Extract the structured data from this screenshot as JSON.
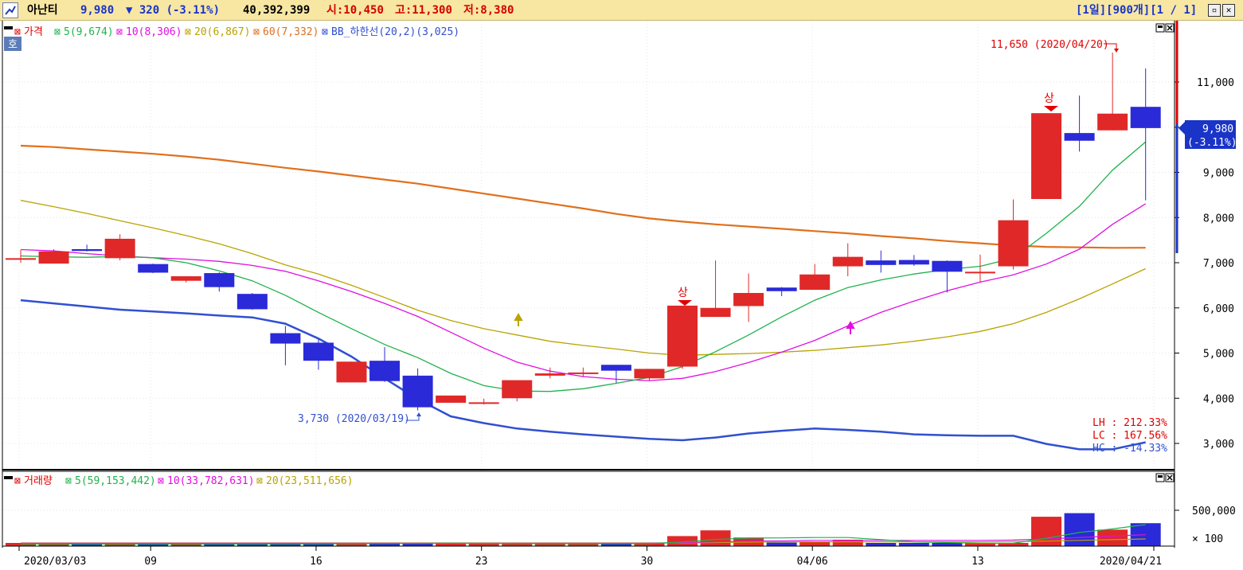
{
  "titlebar": {
    "stock_name": "아난티",
    "price": "9,980",
    "change": "▼ 320 (-3.11%)",
    "volume": "40,392,399",
    "open": "시:10,450",
    "high": "고:11,300",
    "low": "저:8,380",
    "period_controls": "[1일][900개][1 / 1]"
  },
  "price_panel": {
    "legend": [
      {
        "label": "가격",
        "color": "#e00000"
      },
      {
        "label": "5(9,674)",
        "color": "#1fb34a"
      },
      {
        "label": "10(8,306)",
        "color": "#e010e0"
      },
      {
        "label": "20(6,867)",
        "color": "#b8a400"
      },
      {
        "label": "60(7,332)",
        "color": "#e0701c"
      },
      {
        "label": "BB_하한선(20,2)(3,025)",
        "color": "#3050d0"
      }
    ],
    "ho_label": "호",
    "annotation_high": "11,650 (2020/04/20)",
    "annotation_low": "3,730 (2020/03/19)",
    "upper_limit_marks": [
      "상",
      "상"
    ],
    "current_price_badge": "9,980",
    "current_change_badge": "(-3.11%)",
    "lh": "LH : 212.33%",
    "lc": "LC : 167.56%",
    "hc": "HC : -14.33%"
  },
  "volume_panel": {
    "legend": [
      {
        "label": "거래량",
        "color": "#e00000"
      },
      {
        "label": "5(59,153,442)",
        "color": "#1fb34a"
      },
      {
        "label": "10(33,782,631)",
        "color": "#e010e0"
      },
      {
        "label": "20(23,511,656)",
        "color": "#b8a400"
      }
    ],
    "y_ticks": [
      "500,000",
      "× 100"
    ]
  },
  "x_axis": [
    "2020/03/03",
    "09",
    "16",
    "23",
    "30",
    "04/06",
    "13",
    "2020/04/21"
  ],
  "chart_data": {
    "type": "candlestick",
    "y_ticks": [
      3000,
      4000,
      5000,
      6000,
      7000,
      8000,
      9000,
      10000,
      11000
    ],
    "y_tick_labels": [
      "3,000",
      "4,000",
      "5,000",
      "6,000",
      "7,000",
      "8,000",
      "9,000",
      "10,000",
      "11,000"
    ],
    "ylim": [
      2500,
      12700
    ],
    "candles": [
      {
        "o": 7100,
        "h": 7280,
        "l": 7000,
        "c": 7100
      },
      {
        "o": 6980,
        "h": 7300,
        "l": 6980,
        "c": 7250
      },
      {
        "o": 7300,
        "h": 7400,
        "l": 7250,
        "c": 7260
      },
      {
        "o": 7100,
        "h": 7630,
        "l": 7050,
        "c": 7530
      },
      {
        "o": 6970,
        "h": 6980,
        "l": 6770,
        "c": 6780
      },
      {
        "o": 6600,
        "h": 6700,
        "l": 6560,
        "c": 6700
      },
      {
        "o": 6770,
        "h": 6790,
        "l": 6360,
        "c": 6460
      },
      {
        "o": 6310,
        "h": 6330,
        "l": 5960,
        "c": 5970
      },
      {
        "o": 5440,
        "h": 5600,
        "l": 4730,
        "c": 5210
      },
      {
        "o": 5230,
        "h": 5310,
        "l": 4630,
        "c": 4830
      },
      {
        "o": 4350,
        "h": 4810,
        "l": 4350,
        "c": 4810
      },
      {
        "o": 4830,
        "h": 5130,
        "l": 4360,
        "c": 4380
      },
      {
        "o": 4500,
        "h": 4660,
        "l": 3730,
        "c": 3800
      },
      {
        "o": 3900,
        "h": 4060,
        "l": 3900,
        "c": 4060
      },
      {
        "o": 3910,
        "h": 3990,
        "l": 3860,
        "c": 3910
      },
      {
        "o": 4000,
        "h": 4400,
        "l": 3930,
        "c": 4400
      },
      {
        "o": 4500,
        "h": 4680,
        "l": 4440,
        "c": 4550
      },
      {
        "o": 4560,
        "h": 4680,
        "l": 4470,
        "c": 4570
      },
      {
        "o": 4740,
        "h": 4740,
        "l": 4340,
        "c": 4610
      },
      {
        "o": 4440,
        "h": 4650,
        "l": 4380,
        "c": 4650
      },
      {
        "o": 4700,
        "h": 6050,
        "l": 4650,
        "c": 6050
      },
      {
        "o": 5800,
        "h": 7050,
        "l": 5800,
        "c": 6000
      },
      {
        "o": 6040,
        "h": 6760,
        "l": 5690,
        "c": 6330
      },
      {
        "o": 6450,
        "h": 6460,
        "l": 6260,
        "c": 6370
      },
      {
        "o": 6400,
        "h": 6970,
        "l": 6400,
        "c": 6740
      },
      {
        "o": 6920,
        "h": 7430,
        "l": 6700,
        "c": 7130
      },
      {
        "o": 7050,
        "h": 7270,
        "l": 6780,
        "c": 6950
      },
      {
        "o": 7060,
        "h": 7170,
        "l": 6930,
        "c": 6960
      },
      {
        "o": 7040,
        "h": 7050,
        "l": 6340,
        "c": 6800
      },
      {
        "o": 6800,
        "h": 7180,
        "l": 6570,
        "c": 6800
      },
      {
        "o": 6920,
        "h": 8400,
        "l": 6850,
        "c": 7940
      },
      {
        "o": 8410,
        "h": 10310,
        "l": 8410,
        "c": 10310
      },
      {
        "o": 9870,
        "h": 10700,
        "l": 9460,
        "c": 9700
      },
      {
        "o": 9930,
        "h": 11650,
        "l": 9930,
        "c": 10300
      },
      {
        "o": 10450,
        "h": 11300,
        "l": 8380,
        "c": 9980
      }
    ],
    "ma5": [
      7150,
      7130,
      7120,
      7140,
      7110,
      7000,
      6820,
      6600,
      6280,
      5900,
      5540,
      5190,
      4900,
      4550,
      4280,
      4160,
      4150,
      4210,
      4330,
      4460,
      4700,
      5030,
      5400,
      5800,
      6170,
      6450,
      6620,
      6750,
      6850,
      6920,
      7100,
      7650,
      8250,
      9050,
      9674
    ],
    "ma10": [
      7290,
      7260,
      7200,
      7150,
      7110,
      7080,
      7030,
      6940,
      6810,
      6600,
      6360,
      6100,
      5810,
      5460,
      5110,
      4800,
      4600,
      4480,
      4420,
      4390,
      4440,
      4590,
      4790,
      5020,
      5280,
      5600,
      5900,
      6150,
      6380,
      6570,
      6730,
      6970,
      7300,
      7850,
      8306
    ],
    "ma20": [
      8380,
      8240,
      8090,
      7930,
      7770,
      7600,
      7420,
      7200,
      6950,
      6750,
      6500,
      6230,
      5950,
      5720,
      5540,
      5400,
      5260,
      5170,
      5090,
      5000,
      4950,
      4970,
      4990,
      5020,
      5060,
      5120,
      5180,
      5260,
      5360,
      5480,
      5650,
      5900,
      6200,
      6530,
      6867
    ],
    "ma60": [
      9590,
      9560,
      9510,
      9460,
      9410,
      9350,
      9280,
      9190,
      9100,
      9020,
      8930,
      8840,
      8750,
      8640,
      8530,
      8420,
      8310,
      8200,
      8080,
      7980,
      7910,
      7850,
      7800,
      7750,
      7700,
      7650,
      7590,
      7540,
      7480,
      7430,
      7380,
      7350,
      7340,
      7330,
      7332
    ],
    "bb_lower": [
      6170,
      6100,
      6030,
      5960,
      5920,
      5880,
      5830,
      5790,
      5650,
      5320,
      4920,
      4440,
      3980,
      3600,
      3450,
      3330,
      3260,
      3200,
      3150,
      3100,
      3070,
      3130,
      3220,
      3280,
      3330,
      3300,
      3260,
      3200,
      3180,
      3170,
      3170,
      2990,
      2870,
      2870,
      3025
    ],
    "volume": [
      30000,
      30000,
      30000,
      30000,
      30000,
      30000,
      30000,
      30000,
      40000,
      40000,
      40000,
      40000,
      40000,
      30000,
      30000,
      30000,
      30000,
      40000,
      40000,
      40000,
      140000,
      220000,
      120000,
      50000,
      60000,
      90000,
      30000,
      30000,
      30000,
      30000,
      40000,
      410000,
      460000,
      230000,
      320000,
      230000
    ],
    "vol_ma5": [
      30000,
      30000,
      30000,
      30000,
      30000,
      30000,
      30000,
      30000,
      30000,
      32000,
      34000,
      36000,
      38000,
      40000,
      38000,
      36000,
      34000,
      34000,
      34000,
      36000,
      58000,
      92000,
      112000,
      114000,
      120000,
      120000,
      90000,
      60000,
      50000,
      40000,
      40000,
      110000,
      190000,
      240000,
      300000,
      330000
    ],
    "vol_ma10": [
      40000,
      40000,
      40000,
      40000,
      40000,
      40000,
      40000,
      40000,
      40000,
      40000,
      40000,
      40000,
      40000,
      40000,
      40000,
      40000,
      40000,
      40000,
      40000,
      40000,
      50000,
      60000,
      70000,
      75000,
      80000,
      80000,
      80000,
      80000,
      80000,
      80000,
      85000,
      100000,
      120000,
      140000,
      160000,
      175000
    ],
    "vol_ma20": [
      45000,
      45000,
      45000,
      45000,
      45000,
      45000,
      45000,
      45000,
      45000,
      45000,
      45000,
      45000,
      45000,
      45000,
      45000,
      45000,
      45000,
      45000,
      45000,
      45000,
      45000,
      50000,
      55000,
      60000,
      60000,
      60000,
      60000,
      60000,
      60000,
      60000,
      62000,
      70000,
      80000,
      90000,
      100000,
      110000
    ]
  }
}
